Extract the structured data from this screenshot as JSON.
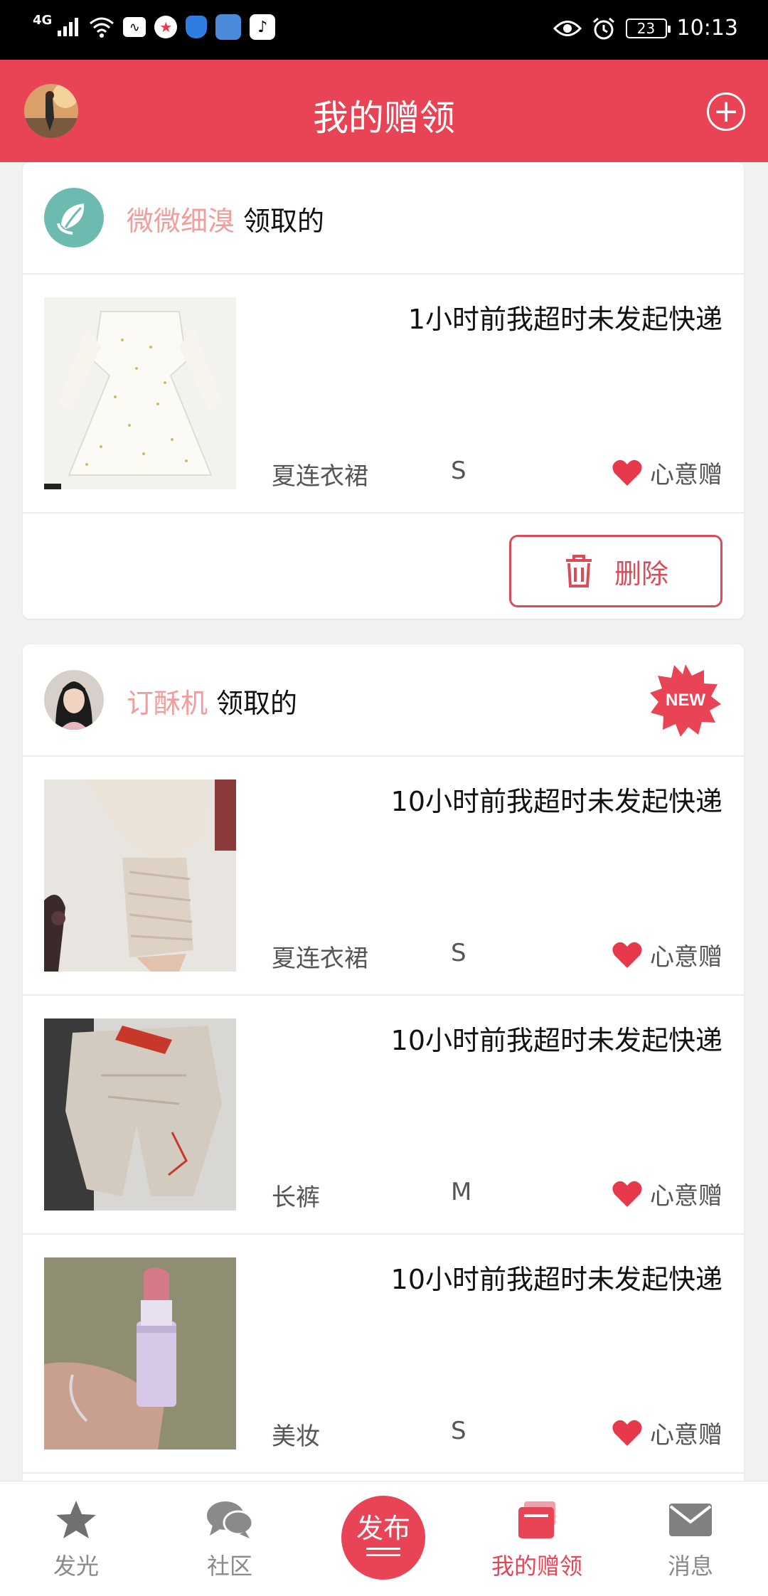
{
  "status_bar": {
    "network": "4G",
    "time": "10:13",
    "battery": "23"
  },
  "header": {
    "title": "我的赠领"
  },
  "cards": [
    {
      "user": "微微细溴",
      "verb": "领取的",
      "is_new": false,
      "items": [
        {
          "status": "1小时前我超时未发起快递",
          "category": "夏连衣裙",
          "size": "S",
          "gift": "心意赠"
        }
      ],
      "delete_label": "删除"
    },
    {
      "user": "订酥机",
      "verb": "领取的",
      "is_new": true,
      "new_label": "NEW",
      "items": [
        {
          "status": "10小时前我超时未发起快递",
          "category": "夏连衣裙",
          "size": "S",
          "gift": "心意赠"
        },
        {
          "status": "10小时前我超时未发起快递",
          "category": "长裤",
          "size": "M",
          "gift": "心意赠"
        },
        {
          "status": "10小时前我超时未发起快递",
          "category": "美妆",
          "size": "S",
          "gift": "心意赠"
        }
      ]
    }
  ],
  "tabbar": {
    "tabs": [
      {
        "label": "发光",
        "icon": "star-icon",
        "active": false
      },
      {
        "label": "社区",
        "icon": "chat-bubbles-icon",
        "active": false
      },
      {
        "label": "发布",
        "icon": "publish-icon",
        "active": false
      },
      {
        "label": "我的赠领",
        "icon": "gift-box-icon",
        "active": true
      },
      {
        "label": "消息",
        "icon": "envelope-icon",
        "active": false
      }
    ]
  },
  "colors": {
    "brand": "#e84455",
    "username": "#ef9d9d",
    "delete": "#d94c5a",
    "heart": "#e8384c"
  }
}
